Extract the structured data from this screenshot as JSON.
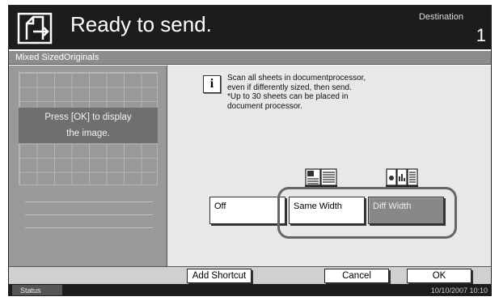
{
  "header": {
    "title": "Ready to send.",
    "destination_label": "Destination",
    "destination_count": "1",
    "icon": "send-job-icon"
  },
  "subheader": {
    "title": "Mixed SizedOriginals"
  },
  "preview": {
    "line1": "Press [OK] to display",
    "line2": "the image."
  },
  "info": {
    "icon": "info-icon",
    "lines": [
      "Scan all sheets in documentprocessor,",
      "even if differently sized, then send.",
      "*Up to 30 sheets can be placed in",
      "document processor."
    ]
  },
  "options": {
    "off_label": "Off",
    "same_width_label": "Same Width",
    "diff_width_label": "Diff Width",
    "selected": "Diff Width",
    "same_width_icon": "same-width-originals-icon",
    "diff_width_icon": "diff-width-originals-icon"
  },
  "footer": {
    "add_shortcut_label": "Add Shortcut",
    "cancel_label": "Cancel",
    "ok_label": "OK"
  },
  "status": {
    "tab_label": "Status",
    "datetime": "10/10/2007   10:10"
  },
  "colors": {
    "header_bg": "#1c1c1c",
    "subheader_bg": "#8c8c8c",
    "selected_option_bg": "#888888"
  }
}
